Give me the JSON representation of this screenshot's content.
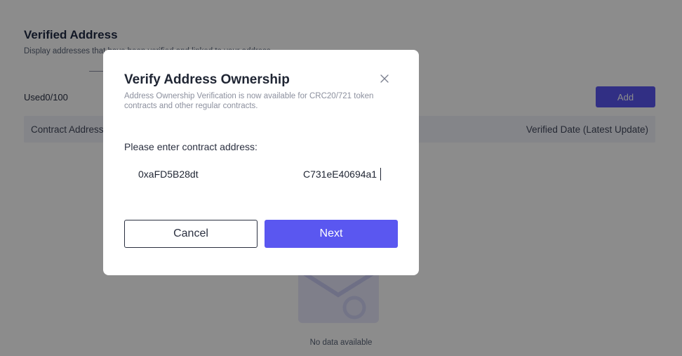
{
  "page": {
    "title": "Verified Address",
    "subtitle": "Display addresses that have been verified and linked to your address",
    "used_label": "Used0/100",
    "add_label": "Add",
    "table": {
      "columns": [
        "Contract Address",
        "Verified Date (Latest Update)"
      ]
    },
    "empty_text": "No data available"
  },
  "modal": {
    "title": "Verify Address Ownership",
    "description": "Address Ownership Verification is now available for CRC20/721 token contracts and other regular contracts.",
    "field_label": "Please enter contract address:",
    "address_value_start": "0xaFD5B28dt",
    "address_value_end": "C731eE40694a1",
    "cancel_label": "Cancel",
    "next_label": "Next",
    "close_icon": "close-icon"
  },
  "colors": {
    "accent": "#5a57f0",
    "overlay": "rgba(0,0,0,0.45)",
    "table_header_bg": "#f1f2f9"
  }
}
